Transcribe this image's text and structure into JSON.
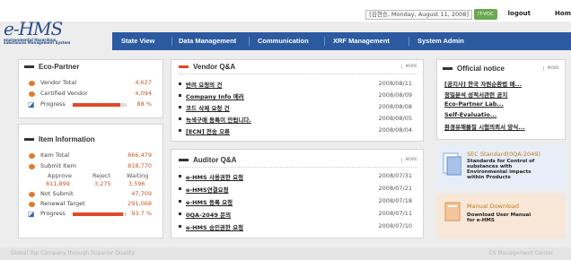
{
  "header": {
    "user_info": "[김현승, Monday, August 11, 2008]",
    "it_badge": "IT-VOC",
    "logout": "logout",
    "home": "Hom",
    "logo_main": "e-HMS",
    "logo_sub_1": "environmental Hazardous",
    "logo_sub_2": "substances Management System"
  },
  "nav": {
    "items": [
      {
        "label": "State View"
      },
      {
        "label": "Data Management"
      },
      {
        "label": "Communication"
      },
      {
        "label": "XRF Management"
      },
      {
        "label": "System Admin"
      }
    ]
  },
  "eco_partner": {
    "title": "Eco-Partner",
    "rows": [
      {
        "label": "Vendor Total",
        "value": "4,627"
      },
      {
        "label": "Certified Vendor",
        "value": "4,094"
      },
      {
        "label": "Progress",
        "value": "88 %",
        "fraction": 0.88
      }
    ]
  },
  "item_info": {
    "title": "Item Information",
    "item_total_label": "Item Total",
    "item_total": "866,479",
    "submit_item_label": "Submit Item",
    "submit_item": "818,770",
    "approve_label": "Approve",
    "reject_label": "Reject",
    "waiting_label": "Waiting",
    "approve": "811,899",
    "reject": "3,275",
    "waiting": "3,596",
    "not_submit_label": "Not Submit",
    "not_submit": "47,709",
    "renewal_label": "Renewal Target",
    "renewal": "291,068",
    "progress_label": "Progress",
    "progress": "93.7 %",
    "progress_fraction": 0.937
  },
  "vendor_qa": {
    "title": "Vendor Q&A",
    "more": "MORE",
    "items": [
      {
        "title": "반려 요청의 건",
        "date": "2008/08/11"
      },
      {
        "title": "Company Info 에러",
        "date": "2008/08/09"
      },
      {
        "title": "코드 삭제 요청 건",
        "date": "2008/08/08"
      },
      {
        "title": "녹색구매 등록이 안됩니다.",
        "date": "2008/08/05"
      },
      {
        "title": "[ECN] 전송 오류",
        "date": "2008/08/04"
      }
    ]
  },
  "auditor_qa": {
    "title": "Auditor Q&A",
    "more": "MORE",
    "items": [
      {
        "title": "e-HMS 사용권한 요청",
        "date": "2008/07/31"
      },
      {
        "title": "e-HMS연결요청",
        "date": "2008/07/21"
      },
      {
        "title": "e-HMS 등록 요청",
        "date": "2008/07/18"
      },
      {
        "title": "0QA-2049 문의",
        "date": "2008/07/11"
      },
      {
        "title": "e-HMS 승인권한 요청",
        "date": "2008/07/10"
      }
    ]
  },
  "official_notice": {
    "title": "Official notice",
    "more": "MORE",
    "items": [
      "[공지사] 한국 자원순환법 매...",
      "정밀분석 성적서관련 공지",
      "Eco-Partner Lab...",
      "Self-Evaluatio...",
      "환경유해물질 시험의뢰서 양식..."
    ]
  },
  "promos": [
    {
      "title": "SEC Standard(0QA-2049)",
      "desc_1": "Standards for Control of",
      "desc_2": "substances with",
      "desc_3": "Environmental impacts",
      "desc_4": "within Products"
    },
    {
      "title": "Manual Download",
      "desc_1": "Download User Manual",
      "desc_2": "for e-HMS",
      "desc_3": "",
      "desc_4": ""
    }
  ],
  "footer": {
    "left": "Global Top Company through Superior Quality",
    "right": "CS Management Center"
  },
  "colors": {
    "nav_bg": "#2c5aa0",
    "accent_orange": "#e07a2c",
    "progress_red": "#e2472a"
  }
}
